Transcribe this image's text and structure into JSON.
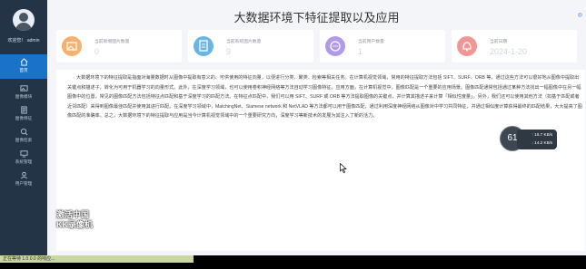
{
  "sidebar": {
    "welcome": "欢迎您！ admin",
    "items": [
      {
        "label": "首页",
        "icon": "home-icon"
      },
      {
        "label": "图像模块",
        "icon": "image-icon"
      },
      {
        "label": "图像特征",
        "icon": "feature-icon"
      },
      {
        "label": "图像检索",
        "icon": "search-icon"
      },
      {
        "label": "系统管理",
        "icon": "system-icon"
      },
      {
        "label": "用户管理",
        "icon": "user-icon"
      }
    ]
  },
  "header": {
    "title": "大数据环境下特征提取以及应用",
    "corner_text": "◎"
  },
  "cards": [
    {
      "label": "当前新增图片数量",
      "value": "0",
      "icon": "image-count-icon",
      "color": "#f6b16f"
    },
    {
      "label": "当前系统图片数量",
      "value": "9",
      "icon": "document-icon",
      "color": "#69b5e6"
    },
    {
      "label": "当前用户数量",
      "value": "1",
      "icon": "chat-icon",
      "color": "#b19ae8"
    },
    {
      "label": "当前日期",
      "value": "2024-1-20",
      "icon": "bell-icon",
      "color": "#f19696"
    }
  ],
  "content": {
    "paragraph": "大数据环境下的特征提取是指面对海量数据时从图像中提取有意义的、可供使用的特征向量，以便进行分类、聚类、检索等相关任务。在计算机视觉领域，常用的特征提取方法包括 SIFT、SURF、ORB 等，通过这些方法可以很好地从图像中提取出关键点和描述子，转化为可用于机器学习的向量形式。此外，在深度学习领域，也可以使用卷积神经网络等方法自动学习图像特征。应用方面，在计算机视觉中，图像匹配是一个重要的应用场景。图像匹配通常包括通过某种方法找出一幅图像中在另一幅图像中的位置，常见的图像匹配方法包括特征点匹配和基于深度学习的匹配方法。在特征点匹配中，我们可以用 SIFT、SURF 或 ORB 等方法提取图像的关键点，并计算其描述子来计算「相似性度量」。另外，我们还可以使用其他方法（如基于匹配或者近邻匹配）来得到图像最佳匹配并使用其进行匹配。在深度学习领域中，MatchingNet、Siamese network 和 NetVLAD 等方法都可以用于图像匹配，通过利用深度神经网络从图像对中学习共同特征，并通过相似度计算获得最终的匹配结果，大大提高了图像匹配的准确率。总之，大数据环境下的特征提取与应用是当今计算机视觉领域中的一个重要研究方向，深度学习等新技术的发展为其注入了新的活力。"
  },
  "overlay": {
    "cpu_badge": "61",
    "upload_speed": "16.7 KB/s",
    "download_speed": "14.2 KB/s",
    "watermark_line1": "激活中国",
    "watermark_line2": "KK录像机"
  },
  "status": {
    "text": "正在等待 1.0.0.0 的响应..."
  }
}
